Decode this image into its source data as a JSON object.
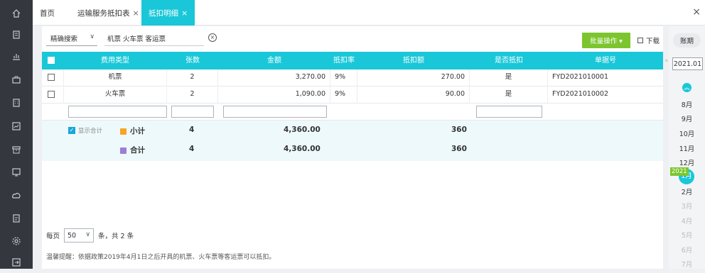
{
  "tabs": [
    {
      "label": "首页",
      "closable": false
    },
    {
      "label": "运输服务抵扣表",
      "closable": true
    },
    {
      "label": "抵扣明细",
      "closable": true,
      "active": true
    }
  ],
  "close_all": "×",
  "tab_close": "×",
  "search": {
    "mode_label": "精确搜索",
    "input_value": "机票 火车票 客运票",
    "clear": "×"
  },
  "toolbar": {
    "batch_label": "批量操作 ▾",
    "download_label": "下载"
  },
  "table": {
    "columns": [
      "费用类型",
      "张数",
      "金额",
      "抵扣率",
      "抵扣额",
      "是否抵扣",
      "单据号"
    ],
    "rows": [
      {
        "type": "机票",
        "count": "2",
        "amount": "3,270.00",
        "rate": "9%",
        "deduct": "270.00",
        "is_deduct": "是",
        "doc_no": "FYD2021010001"
      },
      {
        "type": "火车票",
        "count": "2",
        "amount": "1,090.00",
        "rate": "9%",
        "deduct": "90.00",
        "is_deduct": "是",
        "doc_no": "FYD2021010002"
      }
    ],
    "show_total_label": "显示合计",
    "subtotal": {
      "label": "小计",
      "count": "4",
      "amount": "4,360.00",
      "deduct": "360"
    },
    "total": {
      "label": "合计",
      "count": "4",
      "amount": "4,360.00",
      "deduct": "360"
    }
  },
  "pager": {
    "prefix": "每页",
    "page_size": "50",
    "suffix": "条，共 2 条"
  },
  "tip": "温馨提醒：依据政策2019年4月1日之后开具的机票、火车票等客运票可以抵扣。",
  "period": {
    "button_label": "账期",
    "current": "2021.01",
    "year_badge": "2021",
    "months": [
      {
        "label": "8月",
        "dim": false
      },
      {
        "label": "9月",
        "dim": false
      },
      {
        "label": "10月",
        "dim": false
      },
      {
        "label": "11月",
        "dim": false
      },
      {
        "label": "12月",
        "dim": false
      },
      {
        "label": "1月",
        "dim": false,
        "active": true
      },
      {
        "label": "2月",
        "dim": false
      },
      {
        "label": "3月",
        "dim": true
      },
      {
        "label": "4月",
        "dim": true
      },
      {
        "label": "5月",
        "dim": true
      },
      {
        "label": "6月",
        "dim": true
      },
      {
        "label": "7月",
        "dim": true
      }
    ]
  },
  "sidebar_icons": [
    "home-icon",
    "document-icon",
    "chart-icon",
    "wallet-icon",
    "building-icon",
    "report-icon",
    "archive-icon",
    "monitor-icon",
    "cloud-icon",
    "invoice-icon",
    "settings-icon",
    "export-icon"
  ],
  "colors": {
    "sidebar": "#34373e",
    "accent": "#19c7d8",
    "batch": "#7cc52f",
    "subtotal_icon": "#f5a623",
    "total_icon": "#9b7fd4"
  }
}
